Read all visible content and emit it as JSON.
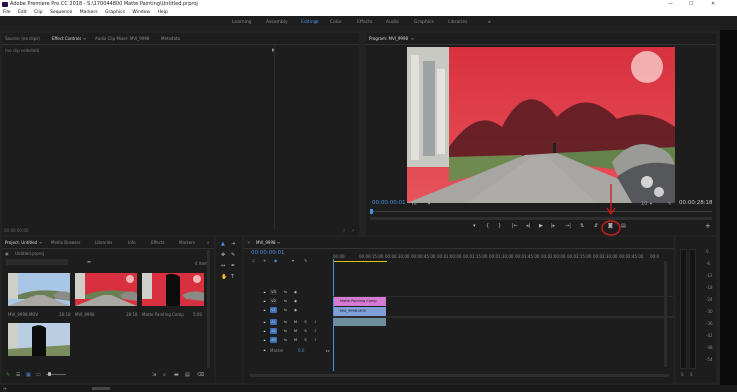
{
  "app": {
    "title": "Adobe Premiere Pro CC 2018 - S:\\170044800 Matte Painting\\Untitled.prproj",
    "win_min": "—",
    "win_max": "☐",
    "win_close": "✕"
  },
  "menu": [
    "File",
    "Edit",
    "Clip",
    "Sequence",
    "Markers",
    "Graphics",
    "Window",
    "Help"
  ],
  "workspaces": {
    "items": [
      "Learning",
      "Assembly",
      "Editing",
      "Color",
      "Effects",
      "Audio",
      "Graphics",
      "Libraries"
    ],
    "active": "Editing",
    "more": "»"
  },
  "source_panel": {
    "tabs": [
      "Source: (no clips)",
      "Effect Controls",
      "Audio Clip Mixer: MVI_9998",
      "Metadata"
    ],
    "active_tab": "Effect Controls",
    "tab_menu": "≡",
    "empty_text": "(no clip selected)",
    "timecode": "00:00:00:00"
  },
  "program_monitor": {
    "title": "Program: MVI_9998",
    "menu": "≡",
    "timecode_current": "00:00:00:01",
    "fit": "Fit",
    "resolution": "1/2",
    "timecode_duration": "00:00:28:18",
    "transport": [
      "▾",
      "{",
      "}",
      "|←",
      "◂|",
      "▶",
      "|▸",
      "→|",
      "⇅",
      "⇵",
      "◙",
      "▤"
    ],
    "add": "+"
  },
  "project_panel": {
    "tabs": [
      "Project: Untitled",
      "Media Browser",
      "Libraries",
      "Info",
      "Effects",
      "Markers"
    ],
    "active_tab": "Project: Untitled",
    "more": "»",
    "file": "Untitled.prproj",
    "item_count": "4 Items",
    "items": [
      {
        "name": "MVI_9998.MOV",
        "duration": "28:18"
      },
      {
        "name": "MVI_9998",
        "duration": "28:18"
      },
      {
        "name": "Matte Painting Comp",
        "duration": "5:00"
      },
      {
        "name": "",
        "duration": ""
      }
    ]
  },
  "timeline": {
    "title": "MVI_9998",
    "menu": "≡",
    "close": "×",
    "timecode": "00:00:00:01",
    "ruler": [
      "00:00",
      "00:00:15:00",
      "00:00:30:00",
      "00:00:45:00",
      "00:01:00:00",
      "00:01:15:00",
      "00:01:30:00",
      "00:01:45:00",
      "00:02:00:00",
      "00:02:15:00",
      "00:02:30:00",
      "00:02:45:00",
      "00:0"
    ],
    "video_tracks": [
      "V3",
      "V2",
      "V1"
    ],
    "audio_tracks": [
      "A1",
      "A2",
      "A3"
    ],
    "master": "Master",
    "master_value": "0.0",
    "clips": {
      "v2": "Matte Painting Comp",
      "v1": "MVI_9998.MOV"
    }
  },
  "audio_meter": {
    "scale": [
      "0",
      "-6",
      "-12",
      "-18",
      "-24",
      "-30",
      "-36",
      "-42",
      "-48",
      "-54"
    ],
    "solo": [
      "S",
      "S"
    ]
  },
  "colors": {
    "accent": "#4a8fe0",
    "clip_v2": "#d57bd3",
    "clip_v1": "#7f9fd6",
    "annotation": "#d11a1a"
  }
}
